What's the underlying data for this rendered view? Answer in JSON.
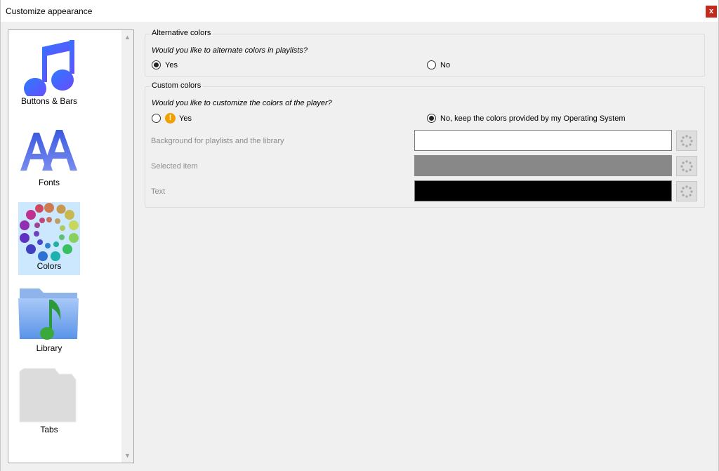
{
  "window": {
    "title": "Customize appearance",
    "close_label": "x"
  },
  "sidebar": {
    "items": [
      {
        "label": "Buttons & Bars",
        "icon": "music-note-icon",
        "selected": false
      },
      {
        "label": "Fonts",
        "icon": "fonts-icon",
        "selected": false
      },
      {
        "label": "Colors",
        "icon": "color-wheel-icon",
        "selected": true
      },
      {
        "label": "Library",
        "icon": "folder-music-icon",
        "selected": false
      },
      {
        "label": "Tabs",
        "icon": "tabs-folder-icon",
        "selected": false
      }
    ]
  },
  "alternative_colors": {
    "title": "Alternative colors",
    "question": "Would you like to alternate colors in playlists?",
    "yes_label": "Yes",
    "no_label": "No",
    "selected": "yes"
  },
  "custom_colors": {
    "title": "Custom colors",
    "question": "Would you like to customize the colors of the player?",
    "yes_label": "Yes",
    "no_label": "No, keep the colors provided by my Operating System",
    "selected": "no",
    "fields": [
      {
        "label": "Background for playlists and the library",
        "color": "#ffffff"
      },
      {
        "label": "Selected item",
        "color": "#888888"
      },
      {
        "label": "Text",
        "color": "#000000"
      }
    ]
  },
  "colors": {
    "accent_selected": "#cce8ff",
    "close_red": "#c42b1c",
    "warning": "#f0a000"
  }
}
